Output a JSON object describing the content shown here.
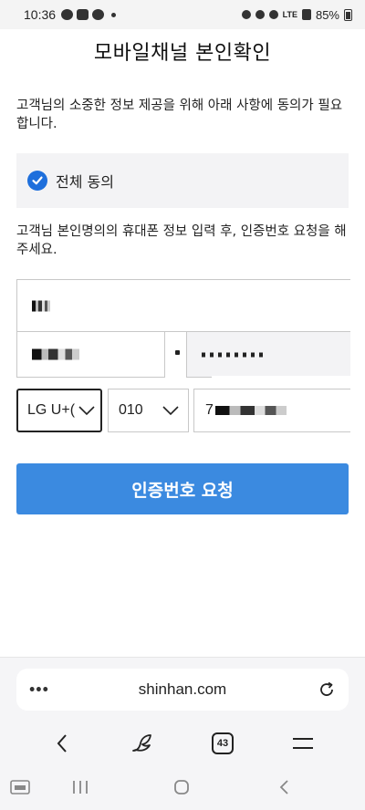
{
  "status_bar": {
    "time": "10:36",
    "network": "LTE",
    "battery": "85%"
  },
  "page": {
    "title": "모바일채널 본인확인",
    "intro": "고객님의 소중한 정보 제공을 위해 아래 사항에 동의가 필요합니다.",
    "agree_all_label": "전체 동의",
    "agree_all_checked": true,
    "instruction": "고객님 본인명의의  휴대폰 정보 입력 후, 인증번호 요청을 해주세요."
  },
  "form": {
    "carrier_select": {
      "value": "LG U+("
    },
    "phone_prefix_select": {
      "value": "010"
    },
    "phone_number_prefix": "7"
  },
  "button": {
    "request_label": "인증번호 요청"
  },
  "browser": {
    "url": "shinhan.com",
    "tab_count": "43"
  },
  "colors": {
    "accent": "#3b8ae0",
    "checkbox": "#1e6fdc"
  }
}
